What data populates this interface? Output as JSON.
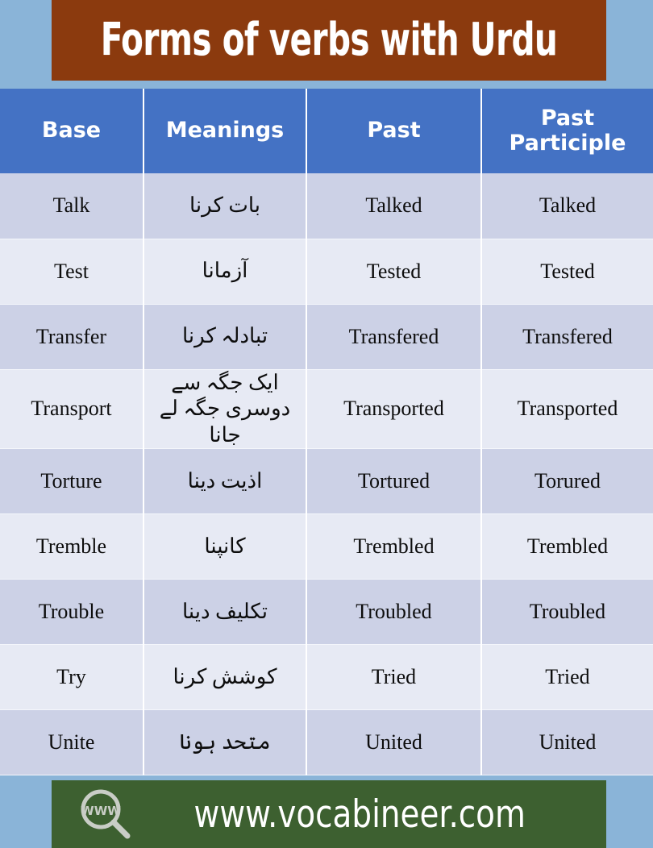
{
  "title": {
    "text": "Forms of verbs with Urdu",
    "background_color": "#8b3a0e",
    "text_color": "#ffffff"
  },
  "page": {
    "background_color": "#8ab4d8"
  },
  "table": {
    "header_background": "#4472c4",
    "row_color_odd": "#ccd1e6",
    "row_color_even": "#e7eaf4",
    "columns": [
      "Base",
      "Meanings",
      "Past",
      "Past Participle"
    ],
    "rows": [
      {
        "base": "Talk",
        "meaning": "بات کرنا",
        "past": "Talked",
        "past_participle": "Talked"
      },
      {
        "base": "Test",
        "meaning": "آزمانا",
        "past": "Tested",
        "past_participle": "Tested"
      },
      {
        "base": "Transfer",
        "meaning": "تبادلہ کرنا",
        "past": "Transfered",
        "past_participle": "Transfered"
      },
      {
        "base": "Transport",
        "meaning": "ایک جگہ سے دوسری جگہ لے جانا",
        "past": "Transported",
        "past_participle": "Transported"
      },
      {
        "base": "Torture",
        "meaning": "اذیت دینا",
        "past": "Tortured",
        "past_participle": "Torured"
      },
      {
        "base": "Tremble",
        "meaning": "کانپنا",
        "past": "Trembled",
        "past_participle": "Trembled"
      },
      {
        "base": "Trouble",
        "meaning": "تکلیف دینا",
        "past": "Troubled",
        "past_participle": "Troubled"
      },
      {
        "base": "Try",
        "meaning": "کوشش کرنا",
        "past": "Tried",
        "past_participle": "Tried"
      },
      {
        "base": "Unite",
        "meaning": "متحد ہونا",
        "past": "United",
        "past_participle": "United"
      }
    ]
  },
  "footer": {
    "url": "www.vocabineer.com",
    "icon_label": "WWW",
    "background_color": "#3d6030",
    "text_color": "#ffffff"
  }
}
